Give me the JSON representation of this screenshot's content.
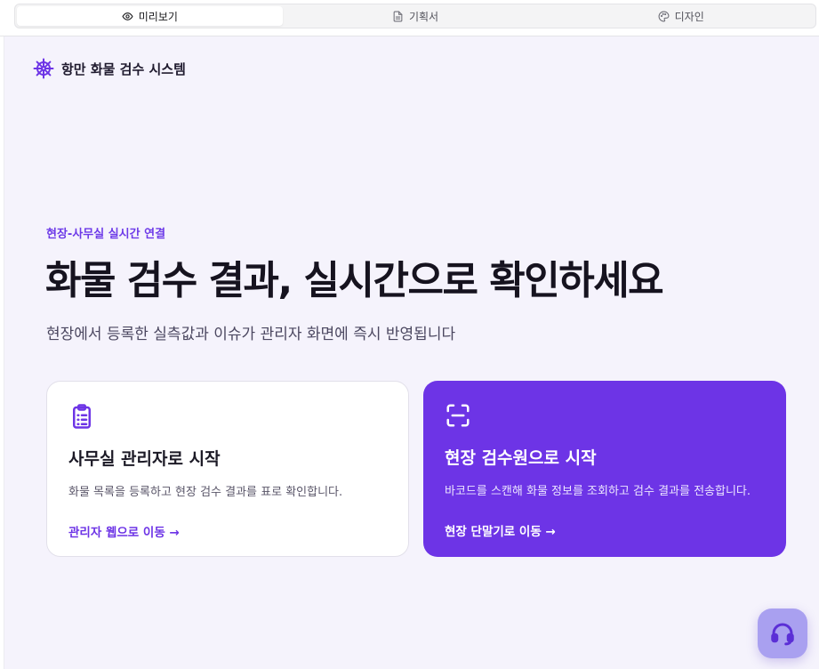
{
  "tabs": [
    {
      "label": "미리보기",
      "icon": "eye-icon",
      "active": true
    },
    {
      "label": "기획서",
      "icon": "document-icon",
      "active": false
    },
    {
      "label": "디자인",
      "icon": "palette-icon",
      "active": false
    }
  ],
  "brand": {
    "name": "항만 화물 검수 시스템",
    "icon": "ship-wheel-icon"
  },
  "hero": {
    "eyebrow": "현장-사무실 실시간 연결",
    "headline": "화물 검수 결과, 실시간으로 확인하세요",
    "subhead": "현장에서 등록한 실측값과 이슈가 관리자 화면에 즉시 반영됩니다"
  },
  "cards": [
    {
      "title": "사무실 관리자로 시작",
      "description": "화물 목록을 등록하고 현장 검수 결과를 표로 확인합니다.",
      "link": "관리자 웹으로 이동 →",
      "icon": "clipboard-list-icon"
    },
    {
      "title": "현장 검수원으로 시작",
      "description": "바코드를 스캔해 화물 정보를 조회하고 검수 결과를 전송합니다.",
      "link": "현장 단말기로 이동 →",
      "icon": "scan-icon"
    }
  ],
  "colors": {
    "accent": "#6d34e6",
    "background": "#f5f3fc",
    "support_button": "#a9a0f0"
  },
  "support": {
    "icon": "headset-icon"
  }
}
